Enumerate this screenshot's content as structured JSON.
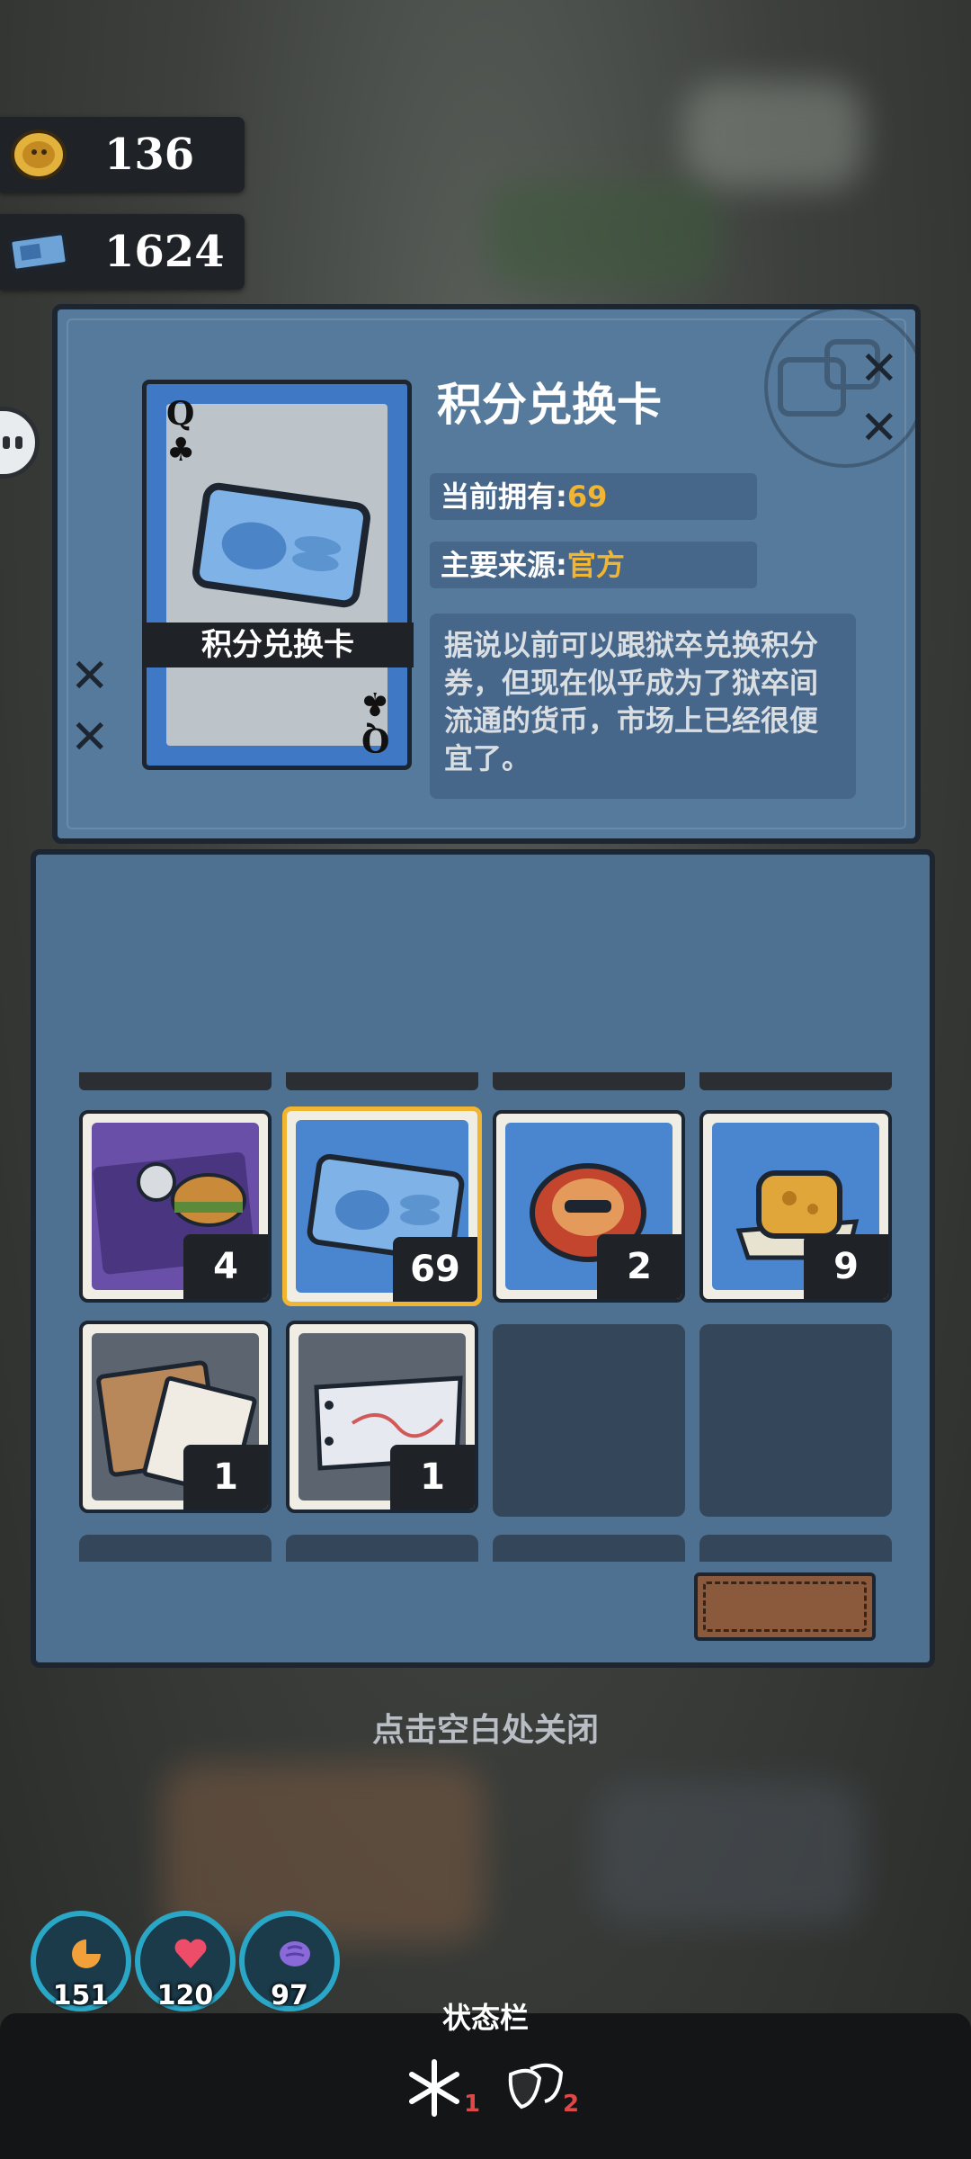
{
  "currency": {
    "coins": "136",
    "tickets": "1624"
  },
  "item_detail": {
    "title": "积分兑换卡",
    "card_rank": "Q",
    "card_name": "积分兑换卡",
    "owned_label": "当前拥有:",
    "owned_value": "69",
    "source_label": "主要来源:",
    "source_value": "官方",
    "description": "据说以前可以跟狱卒兑换积分券，但现在似乎成为了狱卒间流通的货币，市场上已经很便宜了。"
  },
  "inventory": {
    "row1": [
      {
        "icon": "burger-bag-icon",
        "count": "4"
      },
      {
        "icon": "credit-card-icon",
        "count": "69",
        "selected": true
      },
      {
        "icon": "cookie-icon",
        "count": "2"
      },
      {
        "icon": "cheese-bun-icon",
        "count": "9"
      }
    ],
    "row2": [
      {
        "icon": "document-envelope-icon",
        "count": "1"
      },
      {
        "icon": "note-paper-icon",
        "count": "1"
      }
    ]
  },
  "close_hint": "点击空白处关闭",
  "stats": [
    {
      "icon": "hunger-icon",
      "value": "151"
    },
    {
      "icon": "heart-icon",
      "value": "120"
    },
    {
      "icon": "brain-icon",
      "value": "97"
    }
  ],
  "status_bar": {
    "label": "状态栏",
    "effects": [
      {
        "icon": "snowflake-icon",
        "count": "1"
      },
      {
        "icon": "theater-mask-icon",
        "count": "2"
      }
    ]
  },
  "colors": {
    "accent_gold": "#f2b531",
    "panel_blue": "#567a9c",
    "stat_ring": "#2aa7c7",
    "effect_count": "#e04848"
  }
}
